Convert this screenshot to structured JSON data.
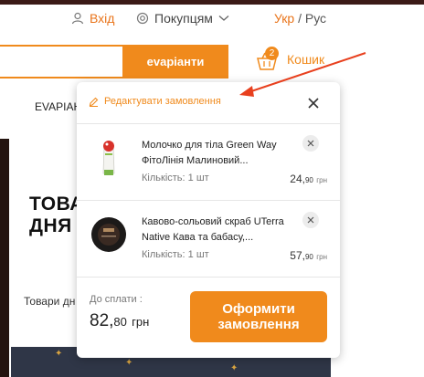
{
  "header": {
    "login_label": "Вхід",
    "buyers_label": "Покупцям",
    "lang_active": "Укр",
    "lang_sep": "/",
    "lang_other": "Рус"
  },
  "search": {
    "button_label": "evaріанти"
  },
  "cart": {
    "label": "Кошик",
    "count": "2"
  },
  "nav": {
    "text": "EVAPІАН"
  },
  "promo": {
    "title_line1": "ТОВА",
    "title_line2": "ДНЯ",
    "subtitle": "Товари дн"
  },
  "popup": {
    "edit_label": "Редактувати замовлення",
    "items": [
      {
        "name": "Молочко для тіла Green Way ФітоЛінія Малиновий...",
        "qty": "Кількість: 1 шт",
        "price_main": "24,",
        "price_kop": "90",
        "currency": "грн"
      },
      {
        "name": "Кавово-сольовий скраб UTerra Native Кава та бабасу,...",
        "qty": "Кількість: 1 шт",
        "price_main": "57,",
        "price_kop": "90",
        "currency": "грн"
      }
    ],
    "total_label": "До сплати :",
    "total_main": "82,",
    "total_kop": "80",
    "total_currency": "грн",
    "checkout_label": "Оформити замовлення"
  },
  "colors": {
    "accent": "#f08a1c",
    "annotation_arrow": "#e8401e"
  }
}
